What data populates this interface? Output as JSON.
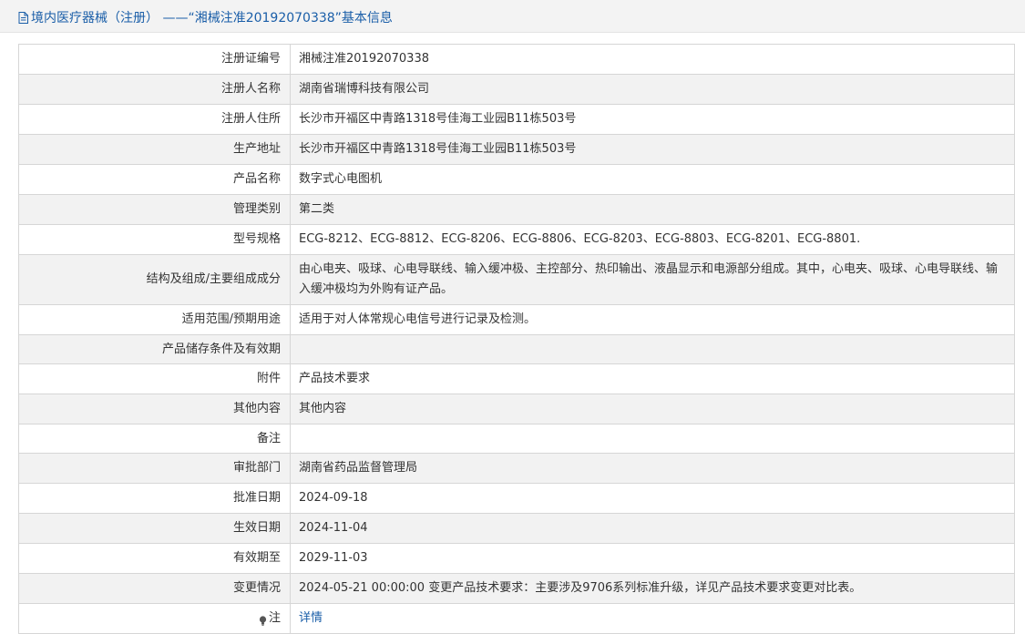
{
  "header": {
    "title": "境内医疗器械（注册） ——“湘械注准20192070338”基本信息",
    "icon": "document-icon"
  },
  "rows": [
    {
      "label": "注册证编号",
      "value": "湘械注准20192070338"
    },
    {
      "label": "注册人名称",
      "value": "湖南省瑞博科技有限公司"
    },
    {
      "label": "注册人住所",
      "value": "长沙市开福区中青路1318号佳海工业园B11栋503号"
    },
    {
      "label": "生产地址",
      "value": "长沙市开福区中青路1318号佳海工业园B11栋503号"
    },
    {
      "label": "产品名称",
      "value": "数字式心电图机"
    },
    {
      "label": "管理类别",
      "value": "第二类"
    },
    {
      "label": "型号规格",
      "value": "ECG-8212、ECG-8812、ECG-8206、ECG-8806、ECG-8203、ECG-8803、ECG-8201、ECG-8801."
    },
    {
      "label": "结构及组成/主要组成成分",
      "value": "由心电夹、吸球、心电导联线、输入缓冲极、主控部分、热印输出、液晶显示和电源部分组成。其中，心电夹、吸球、心电导联线、输入缓冲极均为外购有证产品。"
    },
    {
      "label": "适用范围/预期用途",
      "value": "适用于对人体常规心电信号进行记录及检测。"
    },
    {
      "label": "产品储存条件及有效期",
      "value": ""
    },
    {
      "label": "附件",
      "value": "产品技术要求"
    },
    {
      "label": "其他内容",
      "value": "其他内容"
    },
    {
      "label": "备注",
      "value": ""
    },
    {
      "label": "审批部门",
      "value": "湖南省药品监督管理局"
    },
    {
      "label": "批准日期",
      "value": "2024-09-18"
    },
    {
      "label": "生效日期",
      "value": "2024-11-04"
    },
    {
      "label": "有效期至",
      "value": "2029-11-03"
    },
    {
      "label": "变更情况",
      "value": "2024-05-21 00:00:00 变更产品技术要求：主要涉及9706系列标准升级，详见产品技术要求变更对比表。"
    },
    {
      "label": "注",
      "value": "详情",
      "icon": "lightbulb-icon"
    }
  ],
  "colors": {
    "accent": "#1a5ea8",
    "row_alt": "#f2f2f2",
    "border": "#d6d6d6",
    "header_bg": "#f3f3f3"
  }
}
